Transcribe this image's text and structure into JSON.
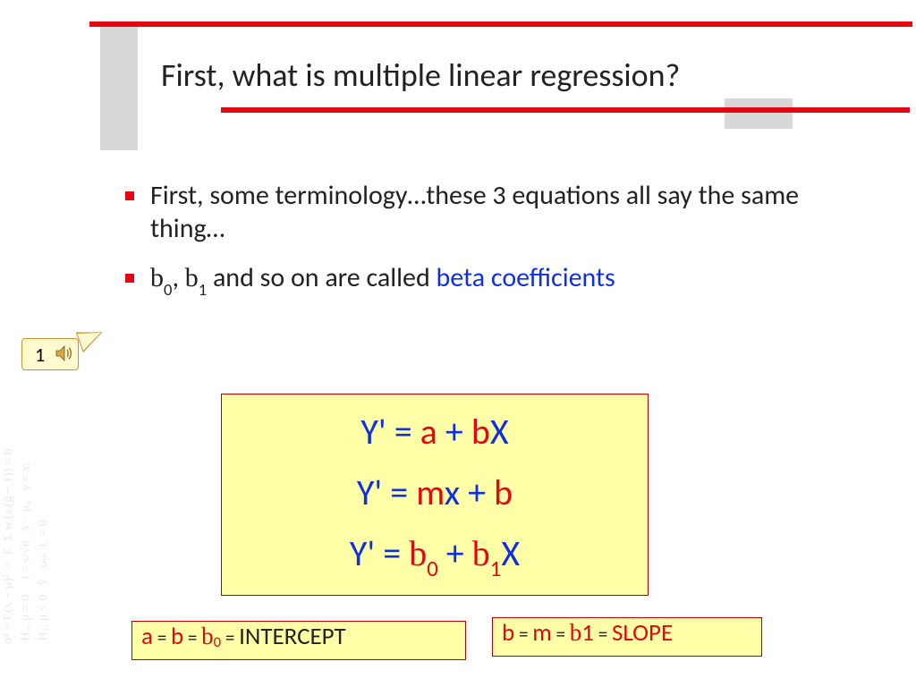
{
  "title": "First, what is multiple linear regression?",
  "bullets": {
    "b1": "First, some terminology…these 3 equations all say the same thing…",
    "b2_pre": ", ",
    "b2_mid": " and so on are called ",
    "b2_em": "beta coefficients",
    "beta0_b": "b",
    "beta0_s": "0",
    "beta1_b": "b",
    "beta1_s": "1"
  },
  "callout_num": "1",
  "eq": {
    "l1_y": "Y' = ",
    "l1_a": "a",
    "l1_plus": " + ",
    "l1_b": "b",
    "l1_x": "X",
    "l2_y": "Y' = ",
    "l2_m": "m",
    "l2_x": "x",
    "l2_plus": " + ",
    "l2_b": "b",
    "l3_y": "Y' = ",
    "l3_b0b": "b",
    "l3_b0s": "0",
    "l3_plus": " + ",
    "l3_b1b": "b",
    "l3_b1s": "1",
    "l3_x": "X"
  },
  "def_left": {
    "a": "a",
    "eq1": " = ",
    "b": "b",
    "eq2": " = ",
    "bb": "b",
    "bs": "0",
    "eq3": " = ",
    "word": "INTERCEPT"
  },
  "def_right": {
    "b": "b",
    "eq1": " = ",
    "m": "m",
    "eq2": " = ",
    "bb": "b",
    "bs": "1",
    "eq3": " = ",
    "word": "SLOPE"
  },
  "bg_text": "σ² = E(x − μ)²  =  E  Σ wᵢ(xᵢ(ĝ − 1)) = ħ\n H₀: μ = 0     t = s/√n   x̄ − μ₀   y = xⱼ\n H₁: μ < 0   ỹ   xₙₚ  tₓ = 0"
}
